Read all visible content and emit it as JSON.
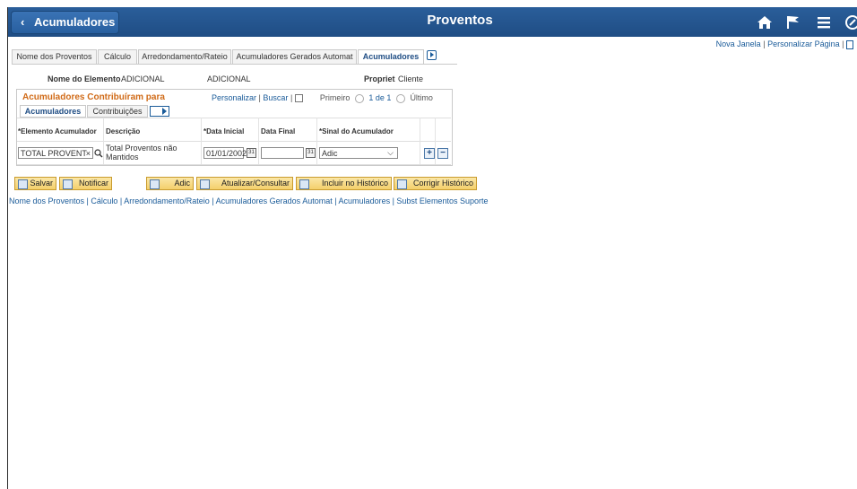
{
  "header": {
    "back_label": "Acumuladores",
    "title": "Proventos"
  },
  "toplinks": {
    "new_window": "Nova Janela",
    "personalize_page": "Personalizar Página",
    "sep": "|"
  },
  "tabs": [
    {
      "label": "Nome dos Proventos"
    },
    {
      "label": "Cálculo"
    },
    {
      "label": "Arredondamento/Rateio"
    },
    {
      "label": "Acumuladores Gerados Automat"
    },
    {
      "label": "Acumuladores"
    }
  ],
  "element_info": {
    "name_label": "Nome do Elemento",
    "name_value": "ADICIONAL",
    "description": "ADICIONAL",
    "owner_label": "Propriet",
    "owner_value": "Cliente"
  },
  "grid": {
    "title": "Acumuladores Contribuíram para",
    "personalize": "Personalizar",
    "find": "Buscar",
    "first": "Primeiro",
    "range": "1 de 1",
    "last": "Último",
    "subtabs": [
      "Acumuladores",
      "Contribuições"
    ],
    "columns": [
      "*Elemento Acumulador",
      "Descrição",
      "*Data Inicial",
      "Data Final",
      "*Sinal do Acumulador"
    ],
    "row": {
      "accumulator": "TOTAL PROVENT",
      "description": "Total Proventos não Mantidos",
      "start_date": "01/01/2002",
      "end_date": "",
      "sign": "Adic"
    }
  },
  "buttons": {
    "save": "Salvar",
    "notify": "Notificar",
    "add": "Adic",
    "update": "Atualizar/Consultar",
    "include_history": "Incluir no Histórico",
    "correct_history": "Corrigir Histórico"
  },
  "bottom_links": "Nome dos Proventos | Cálculo | Arredondamento/Rateio | Acumuladores Gerados Automat | Acumuladores | Subst Elementos Suporte",
  "colors": {
    "header": "#245792",
    "link": "#1a5b99",
    "grid_title": "#d06a17",
    "button": "#f4cf6b"
  }
}
